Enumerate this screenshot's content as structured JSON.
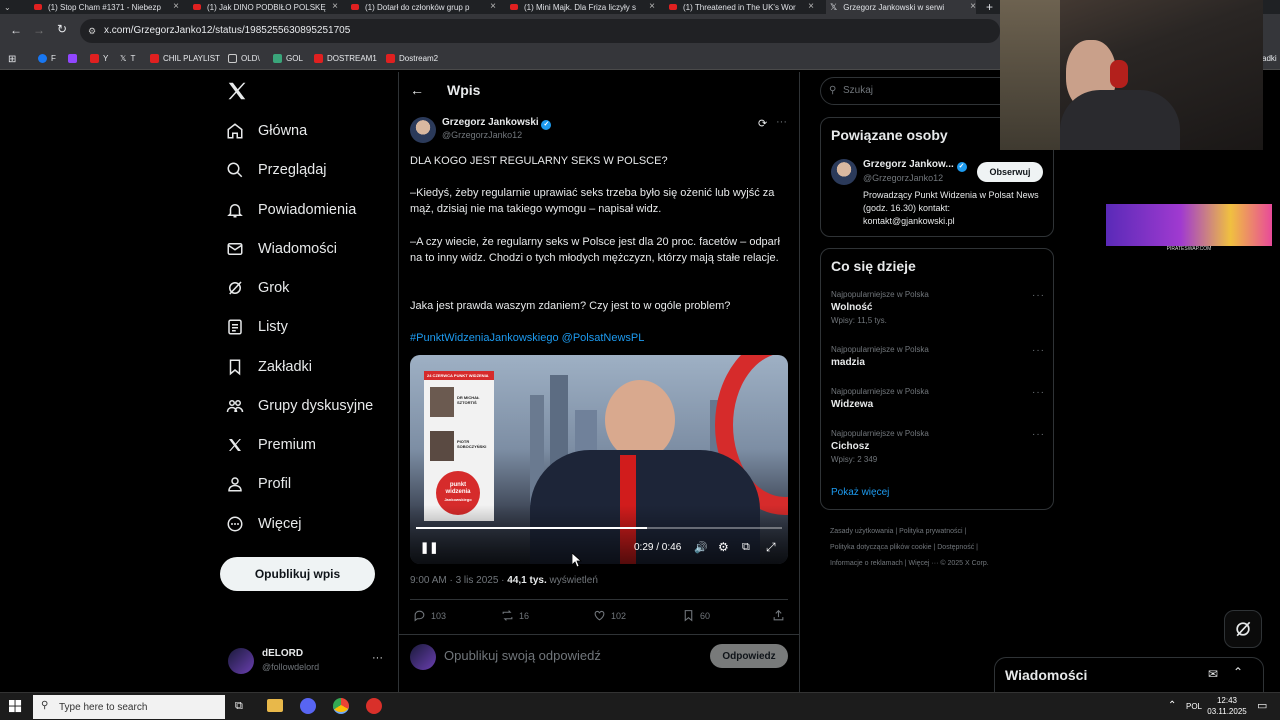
{
  "browser": {
    "tabs": [
      {
        "title": "(1) Stop Cham #1371 - Niebezp"
      },
      {
        "title": "(1) Jak DINO PODBIŁO POLSKĘ"
      },
      {
        "title": "(1) Dotarł do członków grup p"
      },
      {
        "title": "(1) Mini Majk. Dla Friza liczyły s"
      },
      {
        "title": "(1) Threatened in The UK's Wor"
      },
      {
        "title": "Grzegorz Jankowski w serwi"
      }
    ],
    "url": "x.com/GrzegorzJanko12/status/1985255630895251705",
    "bookmarks": [
      "F",
      "Y",
      "T",
      "CHIL PLAYLIST",
      "OLD\\",
      "GOL",
      "DOSTREAM1",
      "Dostream2"
    ],
    "bookmarks_overflow": "adki"
  },
  "nav": {
    "items": [
      {
        "label": "Główna",
        "icon": "home-icon"
      },
      {
        "label": "Przeglądaj",
        "icon": "search-icon"
      },
      {
        "label": "Powiadomienia",
        "icon": "bell-icon"
      },
      {
        "label": "Wiadomości",
        "icon": "mail-icon"
      },
      {
        "label": "Grok",
        "icon": "grok-icon"
      },
      {
        "label": "Listy",
        "icon": "list-icon"
      },
      {
        "label": "Zakładki",
        "icon": "bookmark-icon"
      },
      {
        "label": "Grupy dyskusyjne",
        "icon": "communities-icon"
      },
      {
        "label": "Premium",
        "icon": "x-logo-icon"
      },
      {
        "label": "Profil",
        "icon": "person-icon"
      },
      {
        "label": "Więcej",
        "icon": "more-circle-icon"
      }
    ],
    "post_button": "Opublikuj wpis",
    "account": {
      "name": "dELORD",
      "handle": "@followdelord"
    }
  },
  "header": {
    "title": "Wpis"
  },
  "tweet": {
    "author_name": "Grzegorz Jankowski",
    "author_handle": "@GrzegorzJanko12",
    "paragraphs": [
      "DLA KOGO JEST REGULARNY SEKS W POLSCE?",
      "–Kiedyś, żeby regularnie uprawiać seks trzeba było się ożenić lub wyjść za mąż, dzisiaj nie ma takiego wymogu – napisał widz.",
      "–A czy wiecie, że regularny seks w Polsce jest dla 20 proc. facetów – odparł na to inny widz. Chodzi o tych młodych mężczyzn, którzy mają stałe relacje.",
      "Jaka jest prawda waszym zdaniem? Czy jest to w ogóle problem?"
    ],
    "hashtag": "#PunktWidzeniaJankowskiego",
    "mention": "@PolsatNewsPL",
    "video": {
      "time": "0:29 / 0:46",
      "progress": 0.63,
      "panel": {
        "date": "24 CZERWCA",
        "show": "PUNKT WIDZENIA",
        "guest1": "DR MICHAŁ SZTORTIŚ",
        "guest2": "PIOTR SOBOCZYŃSKI",
        "logo_line1": "punkt",
        "logo_line2": "widzenia",
        "logo_line3": "Jankowskiego"
      }
    },
    "meta_time": "9:00 AM · 3 lis 2025 · ",
    "views_count": "44,1 tys.",
    "views_label": " wyświetleń",
    "actions": {
      "replies": "103",
      "reposts": "16",
      "likes": "102",
      "bookmarks": "60"
    },
    "reply_placeholder": "Opublikuj swoją odpowiedź",
    "reply_button": "Odpowiedz"
  },
  "search": {
    "placeholder": "Szukaj"
  },
  "related": {
    "title": "Powiązane osoby",
    "name": "Grzegorz Jankow...",
    "handle": "@GrzegorzJanko12",
    "follow": "Obserwuj",
    "bio": "Prowadzący Punkt Widzenia w Polsat News (godz. 16.30) kontakt: kontakt@gjankowski.pl"
  },
  "trends": {
    "title": "Co się dzieje",
    "items": [
      {
        "category": "Najpopularniejsze w Polska",
        "name": "Wolność",
        "count": "Wpisy: 11,5 tys."
      },
      {
        "category": "Najpopularniejsze w Polska",
        "name": "madzia",
        "count": ""
      },
      {
        "category": "Najpopularniejsze w Polska",
        "name": "Widzewa",
        "count": ""
      },
      {
        "category": "Najpopularniejsze w Polska",
        "name": "Cichosz",
        "count": "Wpisy: 2 349"
      }
    ],
    "show_more": "Pokaż więcej"
  },
  "footer": {
    "line1": "Zasady użytkowania  |  Polityka prywatności  |",
    "line2": "Polityka dotycząca plików cookie  |  Dostępność  |",
    "line3": "Informacje o reklamach  |  Więcej ···  © 2025 X Corp."
  },
  "ad_banner": {
    "caption": "PIRATESWAP.COM"
  },
  "messages_drawer": {
    "title": "Wiadomości"
  },
  "taskbar": {
    "search_placeholder": "Type here to search",
    "lang": "POL",
    "time": "12:43",
    "date": "03.11.2025"
  },
  "colors": {
    "accent": "#1d9bf0",
    "background": "#000000",
    "border": "#2f3336",
    "muted": "#71767b"
  }
}
